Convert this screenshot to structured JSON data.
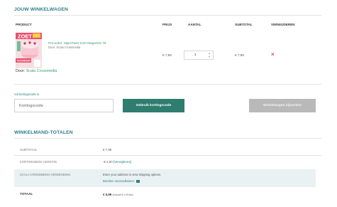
{
  "cart": {
    "title": "JOUW WINKELWAGEN",
    "headers": {
      "product": "PRODUCT",
      "price": "PRIJS",
      "quantity": "AANTAL",
      "subtotal": "SUBTOTAL",
      "remove": "VERWIJDEREN"
    },
    "item": {
      "cover_title": "ZOET",
      "cover_banner": "VOORDAT",
      "cover_ellipsis": "...",
      "door_label": "Door:",
      "door_publisher": "Scala Crossmedia",
      "title": "Pre-order: MjamTaart Zoet Magazine 76",
      "subtitle": "Door: Scala Crossmedia",
      "price": "€ 7,99",
      "quantity": "1",
      "subtotal": "€ 7,99",
      "remove_symbol": "×"
    }
  },
  "coupon": {
    "label": "Vul kortingscode in",
    "placeholder": "Kortingscode",
    "value": "",
    "apply_label": "Gebruik kortingscode",
    "update_label": "Winkelwagen bijwerken"
  },
  "totals": {
    "title": "WINKELMAND-TOTALEN",
    "subtotal_label": "SUBTOTAAL",
    "subtotal_value": "€ 7,99",
    "discount_label": "KORTINGSBON: KERST25",
    "discount_value": "-€ 2,00",
    "discount_remove": "[Verwijderen]",
    "shipping_label": "SCALA CROSSMEDIA VERZENDING",
    "shipping_note": "Enter your address to view shipping options.",
    "shipping_link": "Bereken verzendkosten",
    "total_label": "TOTAAL",
    "total_value": "€ 5,99",
    "total_tax": "(inclusief € 0,49 btw)"
  },
  "colors": {
    "accent": "#2e7d86",
    "link_green": "#3a9c6b",
    "primary_button": "#2e7d6f",
    "disabled_button": "#b9b9b9",
    "remove": "#e2455e",
    "row_highlight": "#eaf1f3"
  },
  "icons": {
    "remove": "close-icon",
    "qty_up": "chevron-up-icon",
    "qty_down": "chevron-down-icon",
    "shipping_calc": "calculator-icon"
  }
}
